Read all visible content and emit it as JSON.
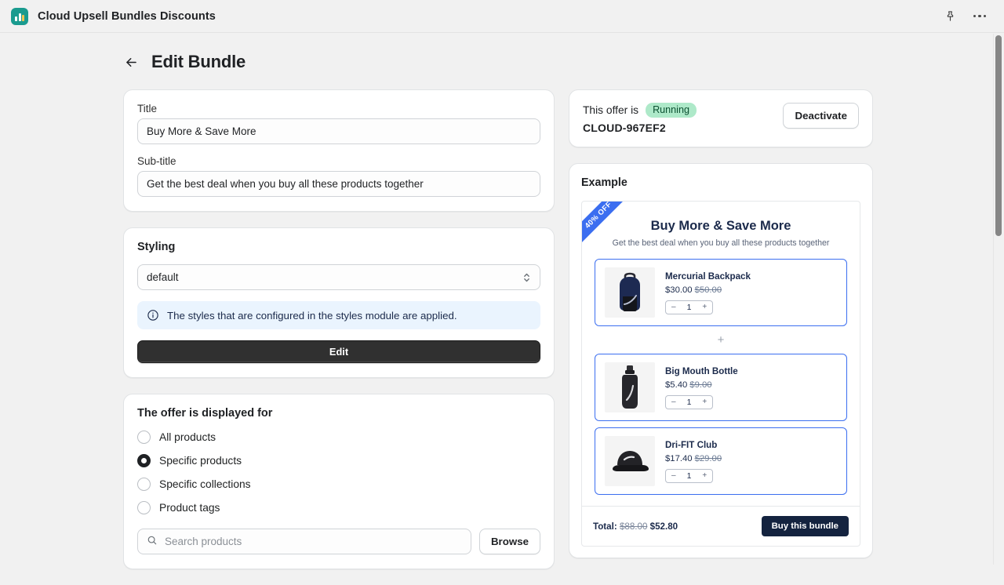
{
  "topbar": {
    "app_icon": "bar-chart-icon",
    "app_title": "Cloud Upsell Bundles Discounts",
    "pin_icon": "pin-icon",
    "more_icon": "ellipsis-icon"
  },
  "header": {
    "back_icon": "arrow-left-icon",
    "title": "Edit Bundle"
  },
  "details": {
    "title_label": "Title",
    "title_value": "Buy More & Save More",
    "subtitle_label": "Sub-title",
    "subtitle_value": "Get the best deal when you buy all these products together"
  },
  "styling": {
    "card_title": "Styling",
    "select_value": "default",
    "select_icon": "chevron-updown-icon",
    "banner_icon": "info-icon",
    "banner_text": "The styles that are configured in the styles module are applied.",
    "edit_label": "Edit"
  },
  "display_for": {
    "card_title": "The offer is displayed for",
    "options": [
      {
        "label": "All products",
        "checked": false
      },
      {
        "label": "Specific products",
        "checked": true
      },
      {
        "label": "Specific collections",
        "checked": false
      },
      {
        "label": "Product tags",
        "checked": false
      }
    ],
    "search_icon": "search-icon",
    "search_placeholder": "Search products",
    "search_value": "",
    "browse_label": "Browse"
  },
  "status": {
    "prefix": "This offer is",
    "badge": "Running",
    "badge_color": "#aee9c9",
    "code": "CLOUD-967EF2",
    "deactivate_label": "Deactivate"
  },
  "example": {
    "section_title": "Example",
    "ribbon": "40% OFF",
    "accent_color": "#3b6ef0",
    "heading": "Buy More & Save More",
    "subheading": "Get the best deal when you buy all these products together",
    "separator": "+",
    "products": [
      {
        "name": "Mercurial Backpack",
        "price": "$30.00",
        "compare_at": "$50.00",
        "quantity": "1",
        "minus": "–",
        "plus": "+",
        "image": "navy-backpack-image"
      },
      {
        "name": "Big Mouth Bottle",
        "price": "$5.40",
        "compare_at": "$9.00",
        "quantity": "1",
        "minus": "–",
        "plus": "+",
        "image": "black-water-bottle-image"
      },
      {
        "name": "Dri-FIT Club",
        "price": "$17.40",
        "compare_at": "$29.00",
        "quantity": "1",
        "minus": "–",
        "plus": "+",
        "image": "black-cap-image"
      }
    ],
    "total_label": "Total:",
    "total_compare_at": "$88.00",
    "total_price": "$52.80",
    "buy_label": "Buy this bundle"
  }
}
